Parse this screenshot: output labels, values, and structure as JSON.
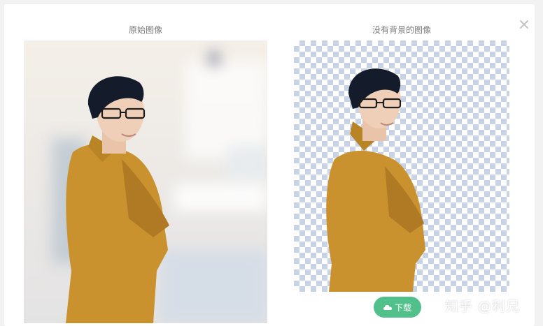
{
  "dialog": {
    "close_icon": "close-icon",
    "original_caption": "原始图像",
    "result_caption": "没有背景的图像",
    "download_label": "下载",
    "download_icon": "cloud-download-icon"
  },
  "watermark": {
    "text": "知乎 @利兄"
  },
  "colors": {
    "accent": "#52c08a",
    "checker": "#c9d3e6",
    "coat": "#c9922e"
  }
}
